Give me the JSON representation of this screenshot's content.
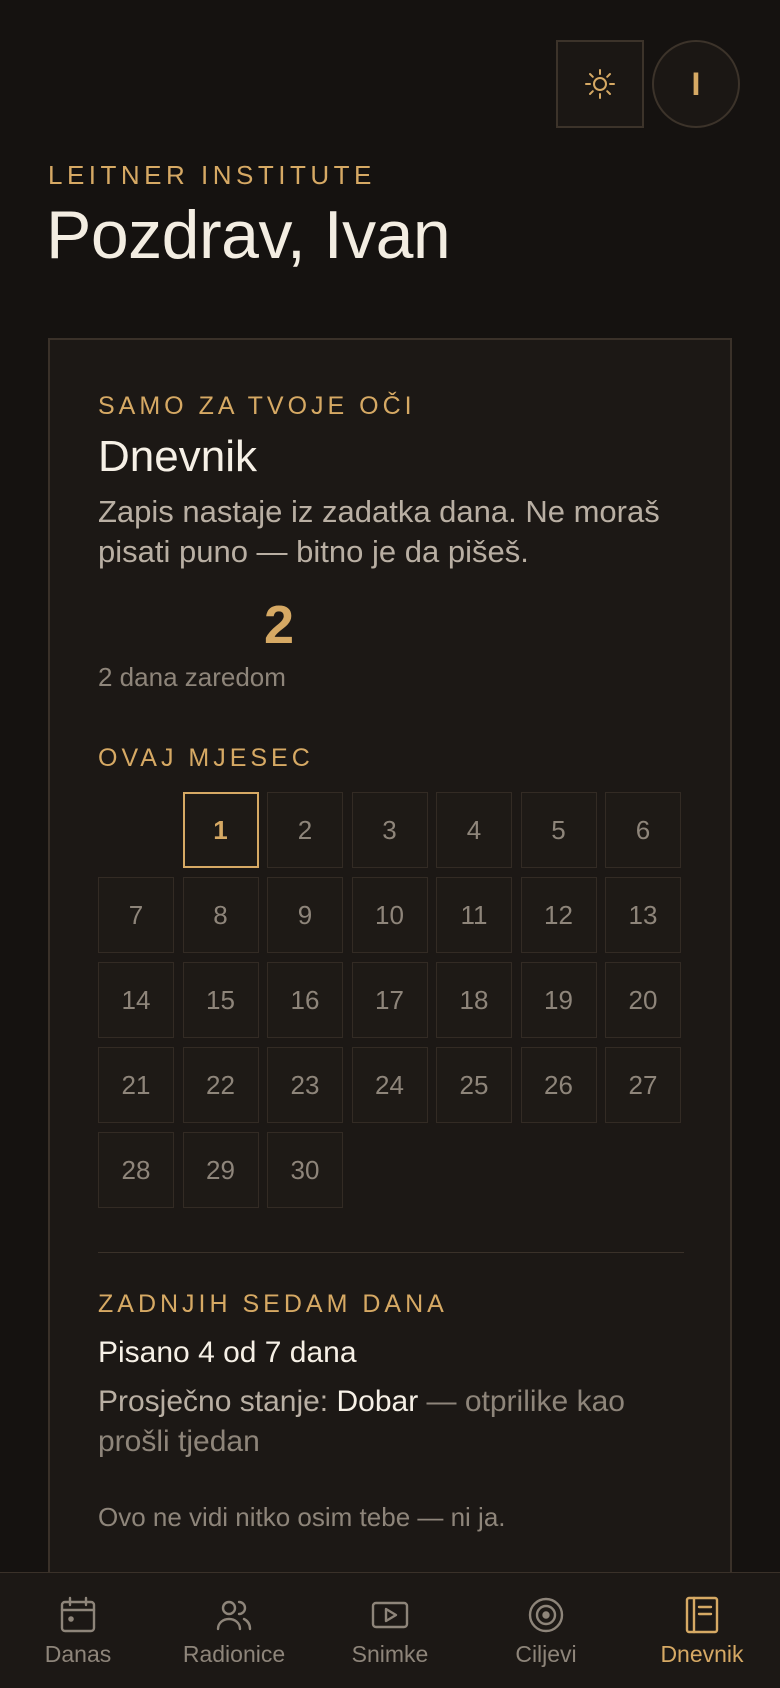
{
  "header": {
    "theme_icon": "sun-icon",
    "avatar_initial": "I",
    "eyebrow": "LEITNER INSTITUTE",
    "greeting": "Pozdrav, Ivan"
  },
  "journal": {
    "eyebrow": "SAMO ZA TVOJE OČI",
    "title": "Dnevnik",
    "description": "Zapis nastaje iz zadatka dana. Ne moraš pisati puno — bitno je da pišeš.",
    "streak_value": "2",
    "streak_label": "2 dana zaredom",
    "month_label": "OVAJ MJESEC",
    "days": [
      "1",
      "2",
      "3",
      "4",
      "5",
      "6",
      "7",
      "8",
      "9",
      "10",
      "11",
      "12",
      "13",
      "14",
      "15",
      "16",
      "17",
      "18",
      "19",
      "20",
      "21",
      "22",
      "23",
      "24",
      "25",
      "26",
      "27",
      "28",
      "29",
      "30"
    ],
    "today": "1",
    "week_label": "ZADNJIH SEDAM DANA",
    "week_count": "Pisano 4 od 7 dana",
    "mood_prefix": "Prosječno stanje: ",
    "mood_value": "Dobar",
    "mood_compare": " — otprilike kao prošli tjedan",
    "privacy_note": "Ovo ne vidi nitko osim tebe — ni ja."
  },
  "nav": {
    "items": [
      {
        "label": "Danas",
        "icon": "calendar-icon"
      },
      {
        "label": "Radionice",
        "icon": "people-icon"
      },
      {
        "label": "Snimke",
        "icon": "video-icon"
      },
      {
        "label": "Ciljevi",
        "icon": "target-icon"
      },
      {
        "label": "Dnevnik",
        "icon": "notebook-icon"
      }
    ],
    "active": "Dnevnik"
  },
  "colors": {
    "accent": "#d6a964",
    "background": "#151210",
    "card": "#1c1815"
  }
}
